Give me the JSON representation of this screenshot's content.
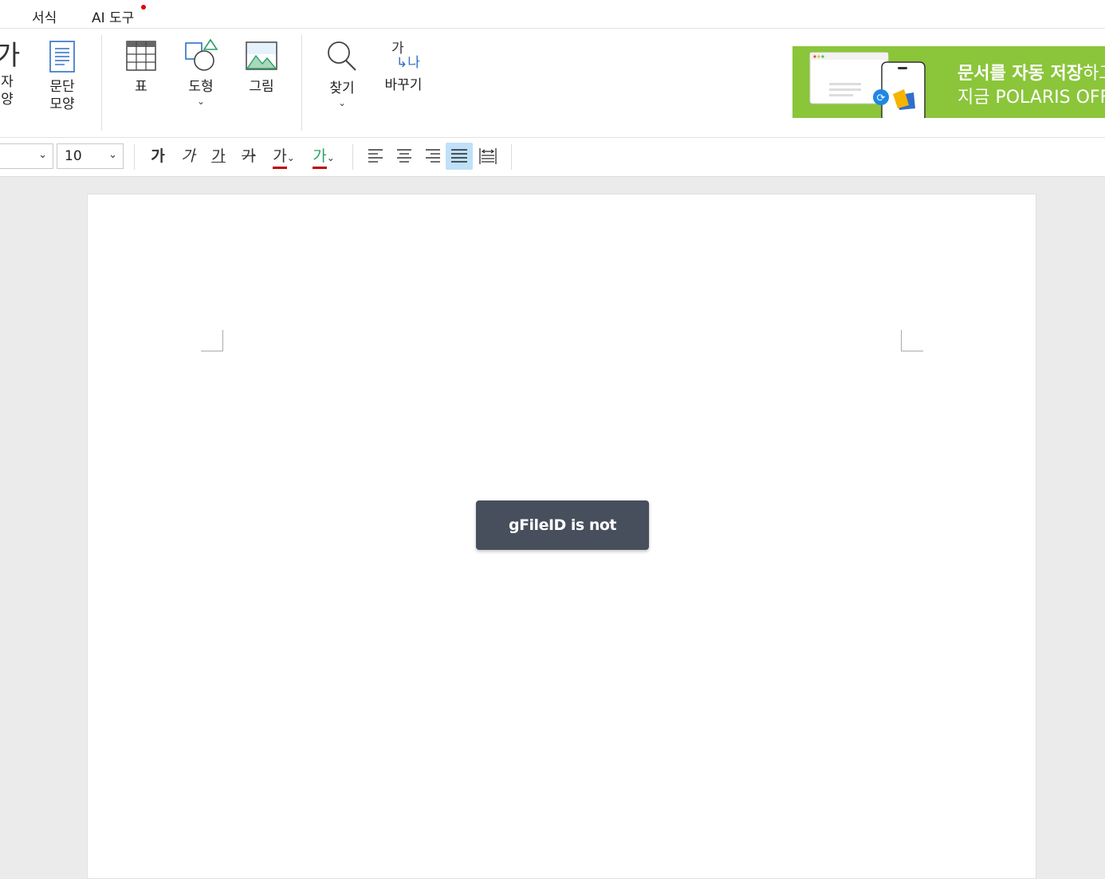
{
  "menu": {
    "items": [
      "서식",
      "AI 도구"
    ]
  },
  "ribbon": {
    "char_shape": "자\n양",
    "char_glyph": "가",
    "para_shape": "문단\n모양",
    "table": "표",
    "shape": "도형",
    "picture": "그림",
    "find": "찾기",
    "replace": "바꾸기",
    "replace_glyph_top": "가",
    "replace_glyph_bottom": "↳나"
  },
  "banner": {
    "line1_bold": "문서를 자동 저장",
    "line1_rest": "하고",
    "line2": "지금 POLARIS OFFICE",
    "bg_color": "#8bc53a"
  },
  "toolbar": {
    "font_name": "",
    "font_size": "10",
    "bold": "가",
    "italic": "가",
    "underline": "가",
    "strike": "가",
    "font_color": "가",
    "highlight": "가",
    "dropdown_arrow": "⌄"
  },
  "document": {
    "toast": "gFileID is not defined"
  },
  "colors": {
    "accent_active": "#bfe0f8",
    "toast_bg": "#474f5c",
    "underline_red": "#c00000"
  }
}
